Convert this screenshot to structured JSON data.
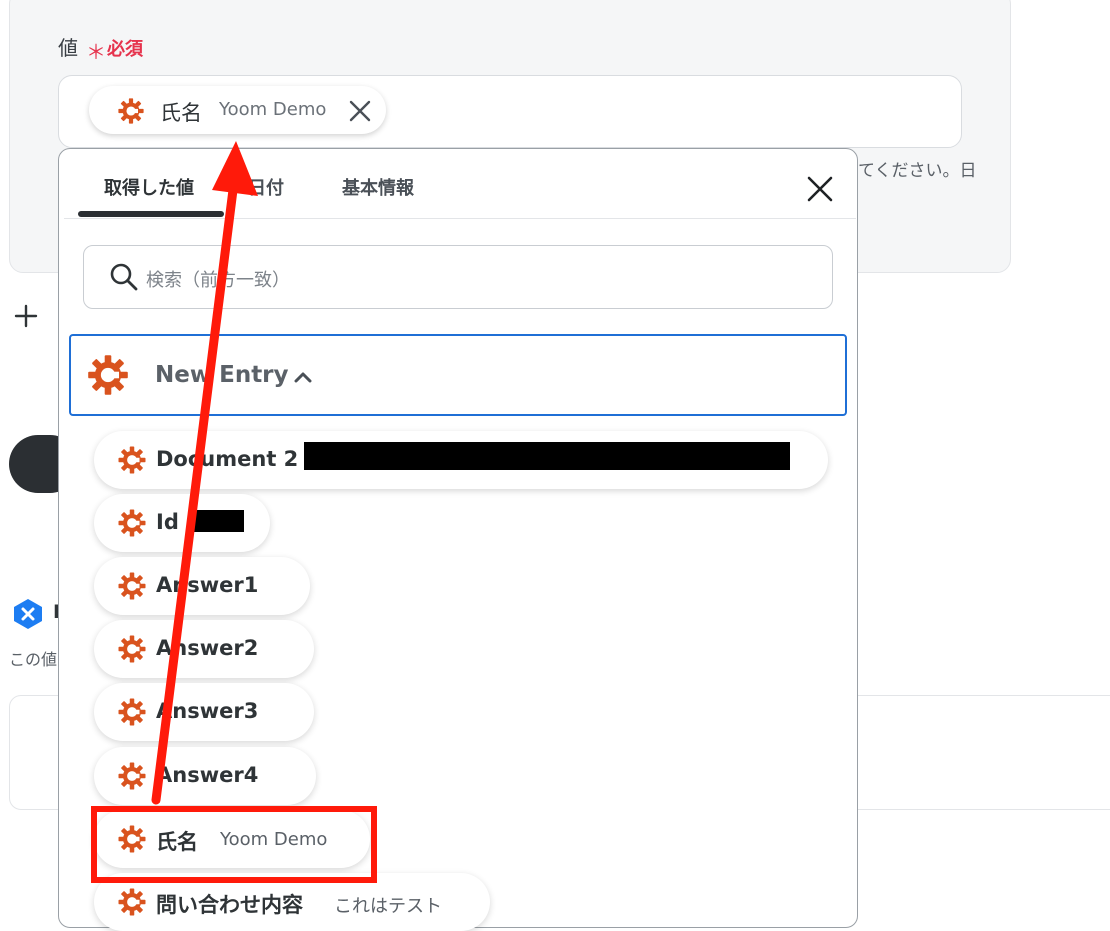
{
  "form": {
    "field_label": "値",
    "required_star": "＊",
    "required_text": "必須",
    "selected_chip": {
      "name": "氏名",
      "meta": "Yoom Demo"
    },
    "help_text_fragment": "てください。日"
  },
  "background": {
    "badge_letter": "I",
    "sub_text_fragment": "この値"
  },
  "popup": {
    "tabs": [
      {
        "label": "取得した値",
        "active": true
      },
      {
        "label": "日付",
        "active": false
      },
      {
        "label": "基本情報",
        "active": false
      }
    ],
    "search_placeholder": "検索（前方一致）",
    "group": {
      "name": "New Entry",
      "expanded": true
    },
    "items": [
      {
        "label": "Document 2",
        "meta": "",
        "redacted": true
      },
      {
        "label": "Id",
        "meta": "",
        "redacted": true
      },
      {
        "label": "Answer1",
        "meta": ""
      },
      {
        "label": "Answer2",
        "meta": ""
      },
      {
        "label": "Answer3",
        "meta": ""
      },
      {
        "label": "Answer4",
        "meta": ""
      },
      {
        "label": "氏名",
        "meta": "Yoom Demo",
        "highlighted": true
      },
      {
        "label": "問い合わせ内容",
        "meta": "これはテスト"
      }
    ]
  },
  "colors": {
    "accent_orange": "#d9531e",
    "annotation_red": "#ff1a0a",
    "focus_blue": "#1f6fd6",
    "required_red": "#e6334d"
  },
  "icons": {
    "item": "app-gear-icon",
    "close": "close-icon",
    "search": "search-icon",
    "chevron": "chevron-up-icon",
    "plus": "plus-icon"
  }
}
